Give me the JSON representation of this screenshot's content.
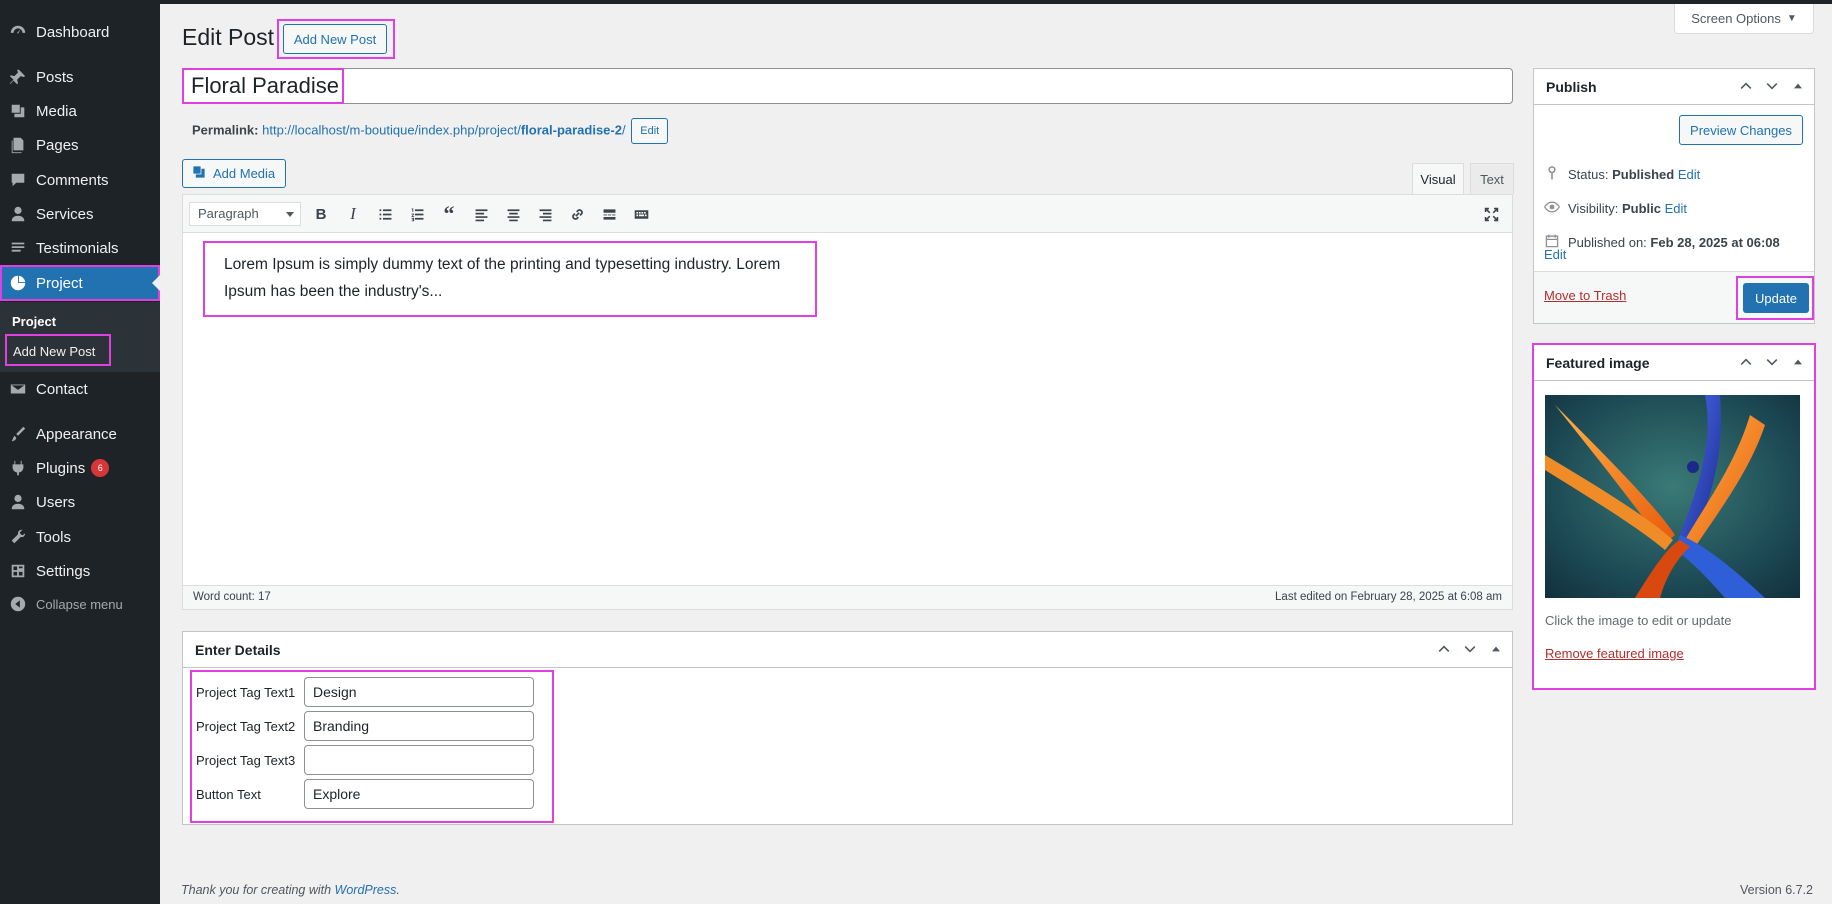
{
  "sidebar": {
    "items": [
      {
        "label": "Dashboard",
        "icon": "dashboard-icon"
      },
      {
        "label": "Posts",
        "icon": "pin-icon"
      },
      {
        "label": "Media",
        "icon": "media-icon"
      },
      {
        "label": "Pages",
        "icon": "pages-icon"
      },
      {
        "label": "Comments",
        "icon": "comment-icon"
      },
      {
        "label": "Services",
        "icon": "user-icon"
      },
      {
        "label": "Testimonials",
        "icon": "testimonial-icon"
      },
      {
        "label": "Project",
        "icon": "pie-chart-icon"
      },
      {
        "label": "Contact",
        "icon": "mail-icon"
      },
      {
        "label": "Appearance",
        "icon": "brush-icon"
      },
      {
        "label": "Plugins",
        "icon": "plugin-icon",
        "badge": "6"
      },
      {
        "label": "Users",
        "icon": "user-icon"
      },
      {
        "label": "Tools",
        "icon": "wrench-icon"
      },
      {
        "label": "Settings",
        "icon": "settings-icon"
      },
      {
        "label": "Collapse menu",
        "icon": "collapse-icon"
      }
    ],
    "submenu_title": "Project",
    "submenu_add": "Add New Post"
  },
  "header": {
    "screen_options": "Screen Options",
    "title": "Edit Post",
    "add_new": "Add New Post"
  },
  "post": {
    "title": "Floral Paradise",
    "permalink_label": "Permalink:",
    "permalink_base": "http://localhost/m-boutique/index.php/project/",
    "permalink_slug": "floral-paradise-2",
    "permalink_end": "/",
    "permalink_edit": "Edit"
  },
  "editor": {
    "add_media": "Add Media",
    "tab_visual": "Visual",
    "tab_text": "Text",
    "format": "Paragraph",
    "content": "Lorem Ipsum is simply dummy text of the printing and typesetting industry. Lorem Ipsum has been the industry's...",
    "word_count": "Word count: 17",
    "last_edited": "Last edited on February 28, 2025 at 6:08 am"
  },
  "details": {
    "title": "Enter Details",
    "fields": [
      {
        "label": "Project Tag Text1",
        "value": "Design"
      },
      {
        "label": "Project Tag Text2",
        "value": "Branding"
      },
      {
        "label": "Project Tag Text3",
        "value": ""
      },
      {
        "label": "Button Text",
        "value": "Explore"
      }
    ]
  },
  "publish": {
    "title": "Publish",
    "preview": "Preview Changes",
    "status_label": "Status:",
    "status_value": "Published",
    "visibility_label": "Visibility:",
    "visibility_value": "Public",
    "published_label": "Published on:",
    "published_value": "Feb 28, 2025 at 06:08",
    "edit": "Edit",
    "trash": "Move to Trash",
    "update": "Update"
  },
  "featured": {
    "title": "Featured image",
    "caption": "Click the image to edit or update",
    "remove": "Remove featured image"
  },
  "footer": {
    "thanks_prefix": "Thank you for creating with ",
    "thanks_link": "WordPress",
    "thanks_suffix": ".",
    "version": "Version 6.7.2"
  },
  "colors": {
    "accent": "#2271b1",
    "sidebar_bg": "#1d2327",
    "highlight": "#e040e0",
    "danger": "#b32d2e"
  }
}
